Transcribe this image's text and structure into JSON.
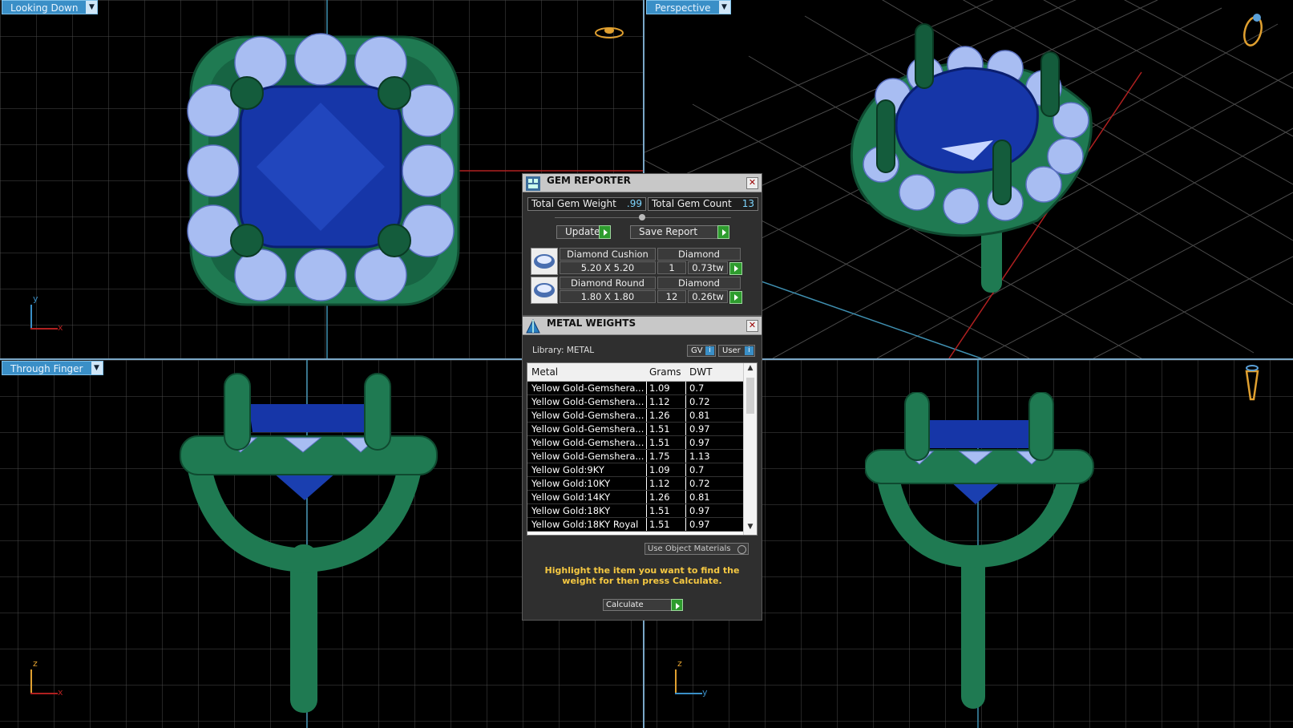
{
  "viewports": {
    "top_left": {
      "label": "Looking Down",
      "axis_v": "y",
      "axis_h": "x"
    },
    "top_right": {
      "label": "Perspective"
    },
    "bottom_left": {
      "label": "Through Finger",
      "axis_v": "z",
      "axis_h": "x"
    },
    "bottom_right": {
      "label": "",
      "axis_v": "z",
      "axis_h": "y"
    }
  },
  "gem_reporter": {
    "title": "GEM REPORTER",
    "total_weight_label": "Total Gem Weight",
    "total_weight_value": ".99",
    "total_count_label": "Total Gem Count",
    "total_count_value": "13",
    "update_label": "Update",
    "save_label": "Save Report",
    "gems": [
      {
        "name": "Diamond Cushion",
        "type": "Diamond",
        "size": "5.20 X 5.20",
        "count": "1",
        "weight": "0.73tw"
      },
      {
        "name": "Diamond Round",
        "type": "Diamond",
        "size": "1.80 X 1.80",
        "count": "12",
        "weight": "0.26tw"
      }
    ]
  },
  "metal_weights": {
    "title": "METAL WEIGHTS",
    "library_label": "Library: METAL",
    "gv_label": "GV",
    "user_label": "User",
    "columns": [
      "Metal",
      "Grams",
      "DWT"
    ],
    "rows": [
      [
        "Yellow Gold-Gemshera...",
        "1.09",
        "0.7"
      ],
      [
        "Yellow Gold-Gemshera...",
        "1.12",
        "0.72"
      ],
      [
        "Yellow Gold-Gemshera...",
        "1.26",
        "0.81"
      ],
      [
        "Yellow Gold-Gemshera...",
        "1.51",
        "0.97"
      ],
      [
        "Yellow Gold-Gemshera...",
        "1.51",
        "0.97"
      ],
      [
        "Yellow Gold-Gemshera...",
        "1.75",
        "1.13"
      ],
      [
        "Yellow Gold:9KY",
        "1.09",
        "0.7"
      ],
      [
        "Yellow Gold:10KY",
        "1.12",
        "0.72"
      ],
      [
        "Yellow Gold:14KY",
        "1.26",
        "0.81"
      ],
      [
        "Yellow Gold:18KY",
        "1.51",
        "0.97"
      ],
      [
        "Yellow Gold:18KY Royal",
        "1.51",
        "0.97"
      ]
    ],
    "use_object_materials": "Use Object Materials",
    "hint": "Highlight the item you want to find the weight for then press Calculate.",
    "calculate_label": "Calculate"
  },
  "colors": {
    "metal": "#1f7a52",
    "sapphire": "#1a3fb0",
    "diamond": "#9fb6f0",
    "grid": "#4a4a4a",
    "accent": "#3a8fc7"
  }
}
